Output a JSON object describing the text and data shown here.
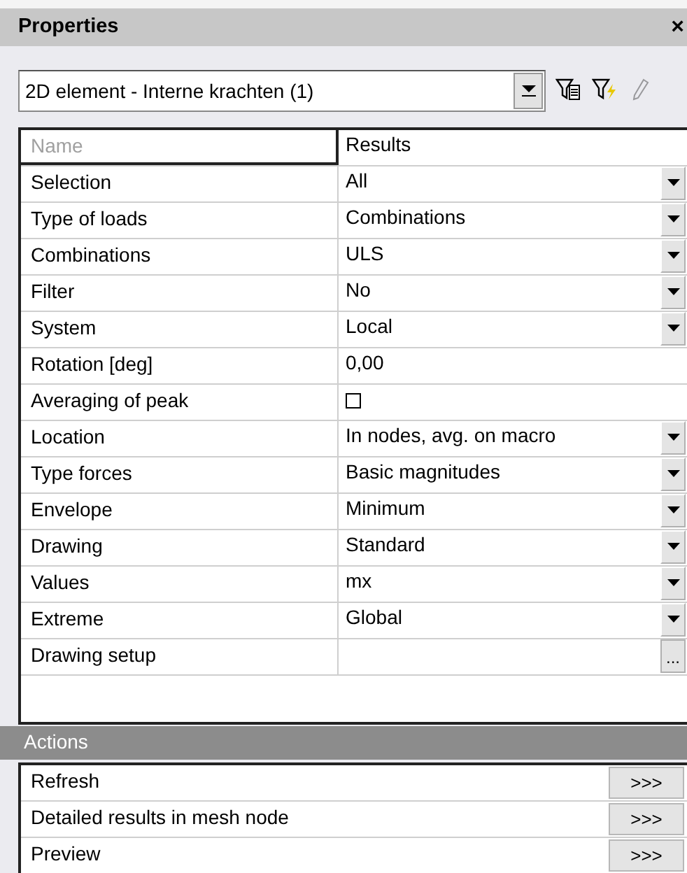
{
  "window": {
    "title": "Properties",
    "close": "×"
  },
  "selector": {
    "value": "2D element - Interne krachten (1)"
  },
  "toolbar": [
    {
      "kind": "filter-table",
      "disabled": false
    },
    {
      "kind": "filter-bolt",
      "disabled": false
    },
    {
      "kind": "pencil",
      "disabled": true
    }
  ],
  "grid": {
    "header": {
      "name": "Name",
      "value": "Results"
    },
    "rows": [
      {
        "kind": "dropdown",
        "label": "Selection",
        "value": "All"
      },
      {
        "kind": "dropdown",
        "label": "Type of loads",
        "value": "Combinations"
      },
      {
        "kind": "dropdown",
        "label": "Combinations",
        "value": "ULS"
      },
      {
        "kind": "dropdown",
        "label": "Filter",
        "value": "No"
      },
      {
        "kind": "dropdown",
        "label": "System",
        "value": "Local"
      },
      {
        "kind": "text",
        "label": "Rotation [deg]",
        "value": "0,00"
      },
      {
        "kind": "checkbox",
        "label": "Averaging of peak",
        "checked": false
      },
      {
        "kind": "dropdown",
        "label": "Location",
        "value": "In nodes, avg. on macro"
      },
      {
        "kind": "dropdown",
        "label": "Type forces",
        "value": "Basic magnitudes"
      },
      {
        "kind": "dropdown",
        "label": "Envelope",
        "value": "Minimum"
      },
      {
        "kind": "dropdown",
        "label": "Drawing",
        "value": "Standard"
      },
      {
        "kind": "dropdown",
        "label": "Values",
        "value": "mx"
      },
      {
        "kind": "dropdown",
        "label": "Extreme",
        "value": "Global"
      },
      {
        "kind": "button",
        "label": "Drawing setup",
        "button": "..."
      }
    ]
  },
  "actions": {
    "title": "Actions",
    "items": [
      {
        "label": "Refresh",
        "button": ">>>"
      },
      {
        "label": "Detailed results in mesh node",
        "button": ">>>"
      },
      {
        "label": "Preview",
        "button": ">>>"
      }
    ]
  }
}
